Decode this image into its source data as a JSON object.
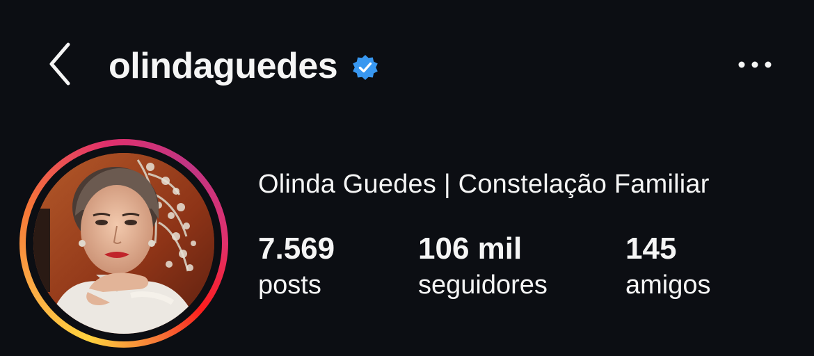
{
  "header": {
    "username": "olindaguedes",
    "verified": true,
    "back_icon": "chevron-left-icon",
    "more_icon": "more-horizontal-icon",
    "verified_color": "#3897f0"
  },
  "profile": {
    "full_name": "Olinda Guedes | Constelação Familiar",
    "avatar": "profile-photo",
    "story_ring": true,
    "stats": {
      "posts": {
        "value": "7.569",
        "label": "posts"
      },
      "followers": {
        "value": "106 mil",
        "label": "seguidores"
      },
      "friends": {
        "value": "145",
        "label": "amigos"
      }
    }
  },
  "colors": {
    "background": "#0c0e13",
    "text": "#f5f5f5"
  }
}
